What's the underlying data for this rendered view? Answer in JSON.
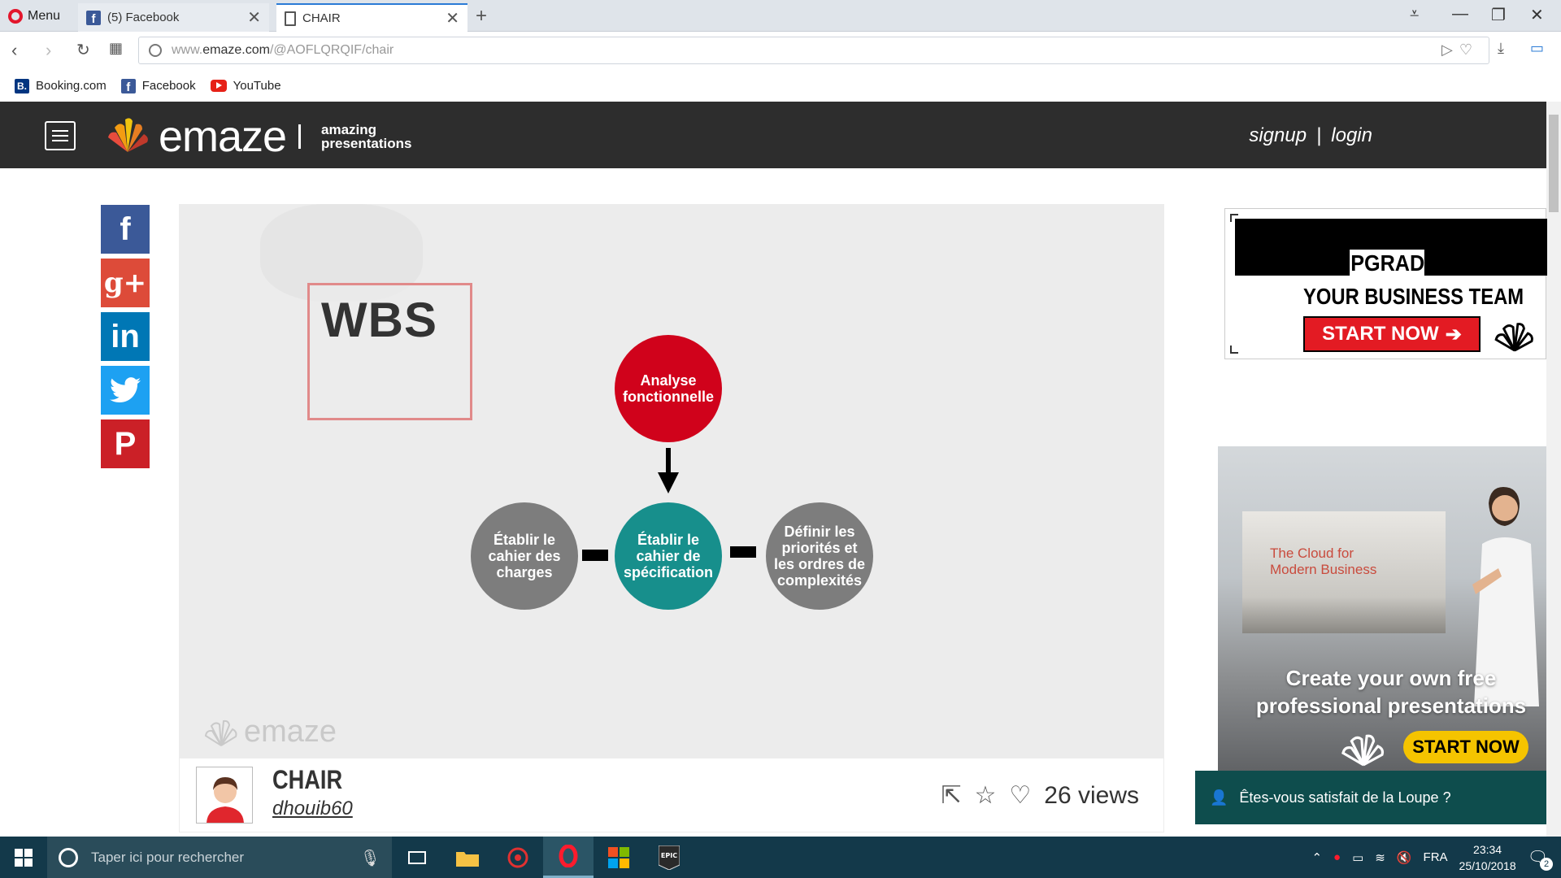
{
  "browser": {
    "menu_label": "Menu",
    "tabs": [
      {
        "title": "(5) Facebook",
        "icon": "facebook-icon",
        "active": false
      },
      {
        "title": "CHAIR",
        "icon": "document-icon",
        "active": true
      }
    ],
    "url": {
      "prefix": "www.",
      "host": "emaze.com",
      "path": "/@AOFLQRQIF/chair"
    },
    "bookmarks": [
      {
        "label": "Booking.com",
        "icon": "booking-icon"
      },
      {
        "label": "Facebook",
        "icon": "facebook-icon"
      },
      {
        "label": "YouTube",
        "icon": "youtube-icon"
      }
    ]
  },
  "header": {
    "logo_text": "emaze",
    "tagline_line1": "amazing",
    "tagline_line2": "presentations",
    "signup": "signup",
    "separator": "|",
    "login": "login"
  },
  "social": [
    "facebook",
    "google-plus",
    "linkedin",
    "twitter",
    "pinterest"
  ],
  "slide": {
    "title": "WBS",
    "nodes": {
      "top": "Analyse fonctionnelle",
      "center": "Établir le cahier de spécification",
      "left": "Établir le cahier des charges",
      "right": "Définir les priorités et les ordres de complexités"
    },
    "watermark": "emaze",
    "colors": {
      "top": "#d0021b",
      "center": "#178f8c",
      "side": "#7d7d7d",
      "title_border": "#e18a8a"
    }
  },
  "presentation": {
    "title": "CHAIR",
    "author": "dhouib60",
    "views": "26 views"
  },
  "ads": {
    "ad1": {
      "headline": "UPGRADE",
      "sub": "YOUR BUSINESS TEAM",
      "button": "START NOW"
    },
    "ad2": {
      "screen_text_1": "The Cloud for",
      "screen_text_2": "Modern Business",
      "headline_1": "Create your own free",
      "headline_2": "professional presentations",
      "button": "START NOW"
    }
  },
  "feedback": "Êtes-vous satisfait de la Loupe ?",
  "taskbar": {
    "search_placeholder": "Taper ici pour rechercher",
    "language": "FRA",
    "time": "23:34",
    "date": "25/10/2018",
    "notification_count": "2"
  }
}
